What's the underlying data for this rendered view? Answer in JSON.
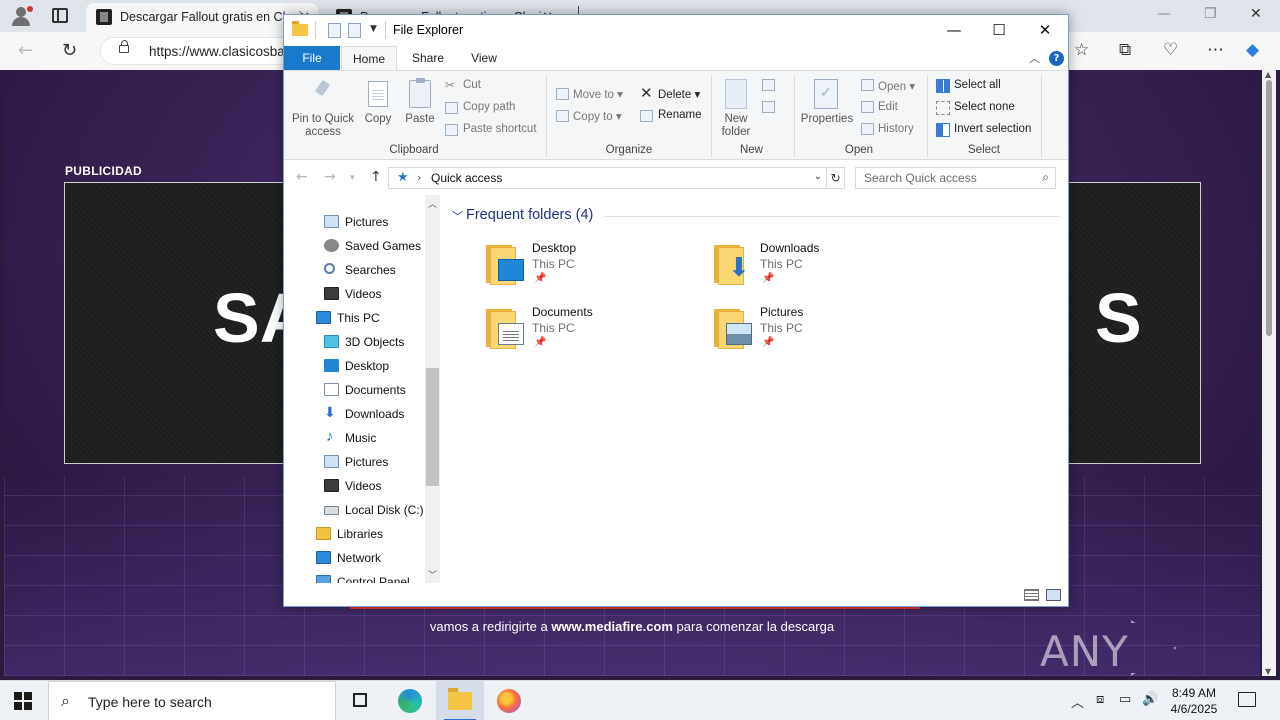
{
  "browser": {
    "tabs": [
      {
        "title": "Descargar Fallout gratis en Clasi"
      },
      {
        "title": "Descargar Fallout gratis en Clasicos Ba"
      }
    ],
    "url": "https://www.clasicosba",
    "window_controls": {
      "minimize": "—",
      "restore": "❐",
      "close": "✕"
    }
  },
  "webpage": {
    "ad_label": "PUBLICIDAD",
    "ad_text_left": "SA",
    "ad_text_right": "S",
    "redirect_prefix": "vamos a redirigirte a",
    "redirect_link": "www.mediafire.com",
    "redirect_suffix": "para comenzar la descarga",
    "watermark": "ANY RUN"
  },
  "explorer": {
    "title": "File Explorer",
    "controls": {
      "minimize": "—",
      "maximize": "☐",
      "close": "✕"
    },
    "ribbon_tabs": {
      "file": "File",
      "home": "Home",
      "share": "Share",
      "view": "View"
    },
    "clipboard": {
      "label": "Clipboard",
      "pin": "Pin to Quick access",
      "copy": "Copy",
      "paste": "Paste",
      "cut": "Cut",
      "copy_path": "Copy path",
      "paste_shortcut": "Paste shortcut"
    },
    "organize": {
      "label": "Organize",
      "move_to": "Move to",
      "copy_to": "Copy to",
      "delete": "Delete",
      "rename": "Rename"
    },
    "new": {
      "label": "New",
      "new_folder": "New folder"
    },
    "open": {
      "label": "Open",
      "properties": "Properties",
      "open": "Open",
      "edit": "Edit",
      "history": "History"
    },
    "select": {
      "label": "Select",
      "select_all": "Select all",
      "select_none": "Select none",
      "invert": "Invert selection"
    },
    "path": "Quick access",
    "search_placeholder": "Search Quick access",
    "nav_pane": [
      {
        "label": "Pictures",
        "icon": "pictures-icon"
      },
      {
        "label": "Saved Games",
        "icon": "saved-games-icon"
      },
      {
        "label": "Searches",
        "icon": "searches-icon"
      },
      {
        "label": "Videos",
        "icon": "videos-icon"
      },
      {
        "label": "This PC",
        "icon": "this-pc-icon"
      },
      {
        "label": "3D Objects",
        "icon": "3d-objects-icon"
      },
      {
        "label": "Desktop",
        "icon": "desktop-icon"
      },
      {
        "label": "Documents",
        "icon": "documents-icon"
      },
      {
        "label": "Downloads",
        "icon": "downloads-icon"
      },
      {
        "label": "Music",
        "icon": "music-icon"
      },
      {
        "label": "Pictures",
        "icon": "pictures-icon"
      },
      {
        "label": "Videos",
        "icon": "videos-icon"
      },
      {
        "label": "Local Disk (C:)",
        "icon": "local-disk-icon"
      },
      {
        "label": "Libraries",
        "icon": "libraries-icon"
      },
      {
        "label": "Network",
        "icon": "network-icon"
      },
      {
        "label": "Control Panel",
        "icon": "control-panel-icon"
      }
    ],
    "section_title": "Frequent folders (4)",
    "folders": [
      {
        "name": "Desktop",
        "location": "This PC"
      },
      {
        "name": "Downloads",
        "location": "This PC"
      },
      {
        "name": "Documents",
        "location": "This PC"
      },
      {
        "name": "Pictures",
        "location": "This PC"
      }
    ]
  },
  "taskbar": {
    "search_placeholder": "Type here to search",
    "time": "8:49 AM",
    "date": "4/6/2025"
  }
}
